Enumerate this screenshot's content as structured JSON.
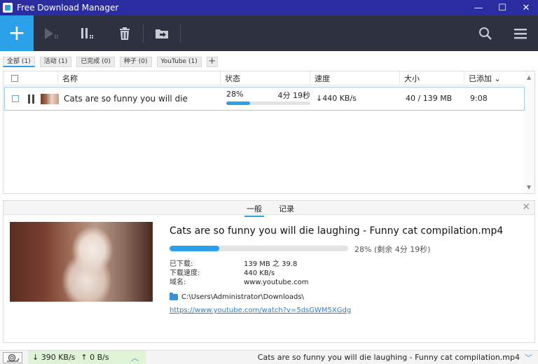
{
  "window": {
    "title": "Free Download Manager",
    "minimize": "—",
    "maximize": "☐",
    "close": "✕"
  },
  "toolbar": {
    "add_label": "+"
  },
  "filters": [
    {
      "label": "全部 (1)",
      "active": true
    },
    {
      "label": "活动 (1)"
    },
    {
      "label": "已完成 (0)"
    },
    {
      "label": "种子 (0)"
    },
    {
      "label": "YouTube (1)"
    }
  ],
  "filter_add": "+",
  "list": {
    "columns": {
      "name": "名称",
      "status": "状态",
      "speed": "速度",
      "size": "大小",
      "added": "已添加 ⌄"
    },
    "rows": [
      {
        "name": "Cats are so funny you will die l...",
        "progress_text": "28%",
        "progress": 0.28,
        "eta": "4分 19秒",
        "speed": "↓440 KB/s",
        "size": "40 / 139 MB",
        "added": "9:08"
      }
    ]
  },
  "details": {
    "tabs": [
      "一般",
      "记录"
    ],
    "title": "Cats are so funny you will die laughing - Funny cat compilation.mp4",
    "progress": 0.28,
    "progress_text": "28% (剩余 4分 19秒)",
    "info": [
      {
        "k": "已下载:",
        "v": "139 MB 之 39.8"
      },
      {
        "k": "下载速度:",
        "v": "440 KB/s"
      },
      {
        "k": "域名:",
        "v": "www.youtube.com"
      }
    ],
    "folder": "C:\\Users\\Administrator\\Downloads\\",
    "link": "https://www.youtube.com/watch?v=5dsGWM5XGdg"
  },
  "status": {
    "down": "↓ 390 KB/s",
    "up": "↑ 0 B/s",
    "file": "Cats are so funny you will die laughing - Funny cat compilation.mp4"
  },
  "colors": {
    "accent": "#2aa1e8",
    "titlebar": "#2b2ca0",
    "toolbar": "#2e3240"
  }
}
